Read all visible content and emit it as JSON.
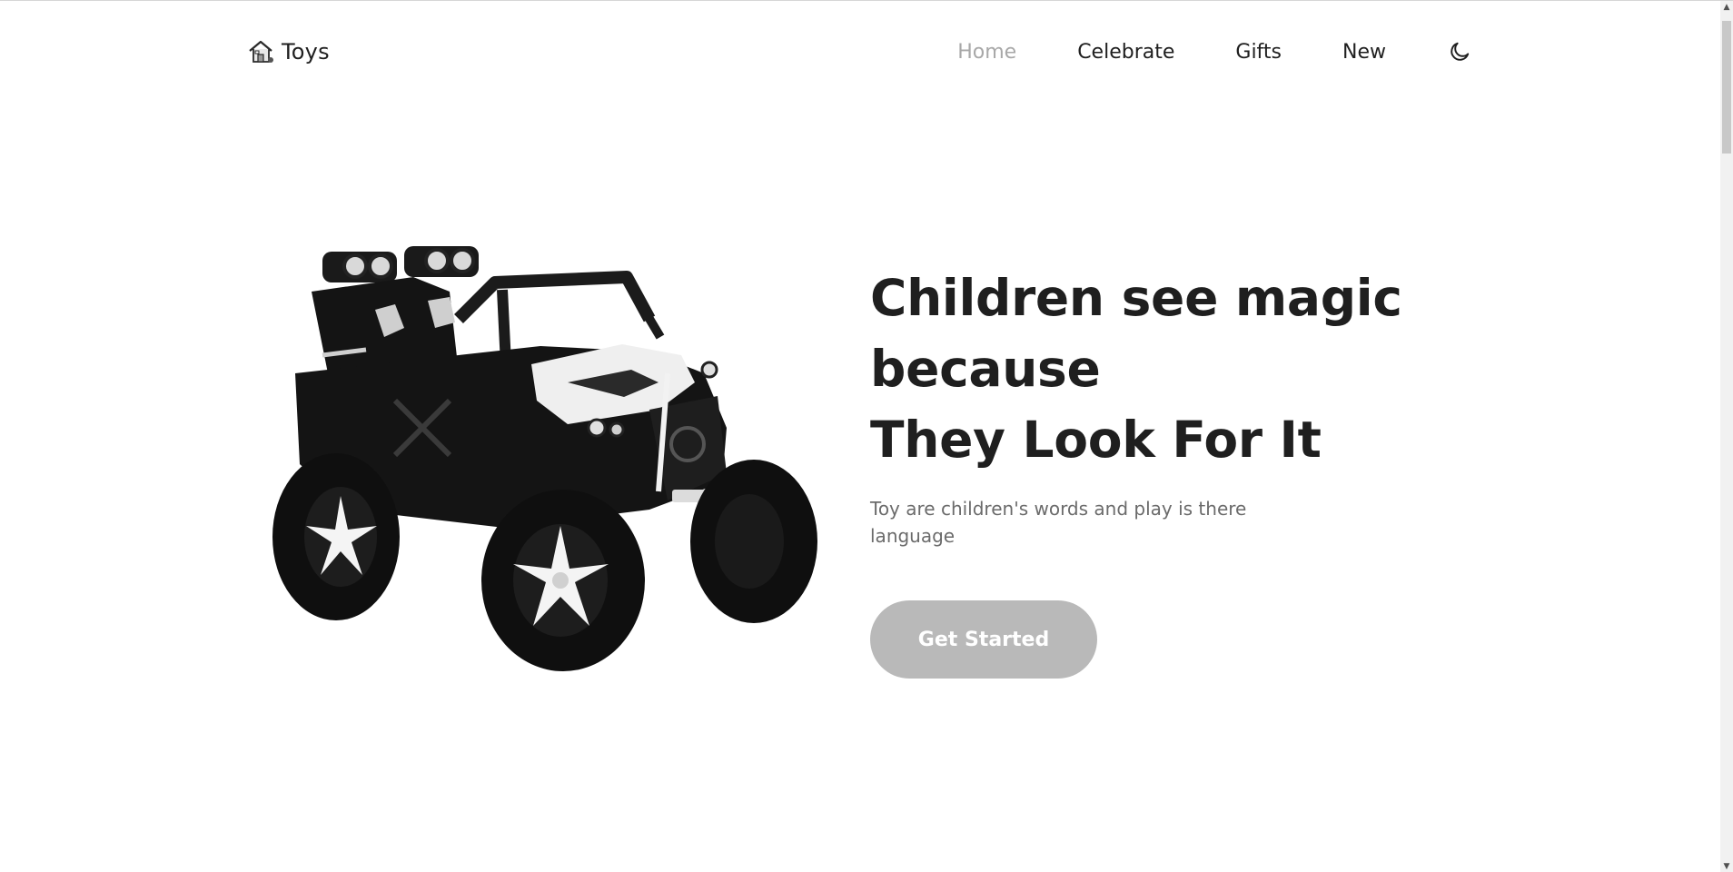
{
  "brand": {
    "name": "Toys",
    "icon": "toy-house-icon"
  },
  "nav": {
    "items": [
      {
        "label": "Home",
        "active": true
      },
      {
        "label": "Celebrate",
        "active": false
      },
      {
        "label": "Gifts",
        "active": false
      },
      {
        "label": "New",
        "active": false
      }
    ],
    "theme_icon": "moon-icon"
  },
  "hero": {
    "title_line1": "Children see magic",
    "title_line2": "because",
    "title_line3": "They Look For It",
    "description": "Toy are children's words and play is there language",
    "cta_label": "Get Started",
    "image_icon": "toy-car-image"
  },
  "colors": {
    "text": "#1f1f1f",
    "active_nav": "#a8a8a8",
    "muted_text": "#6b6b6b",
    "button": "#b9b9b9"
  }
}
